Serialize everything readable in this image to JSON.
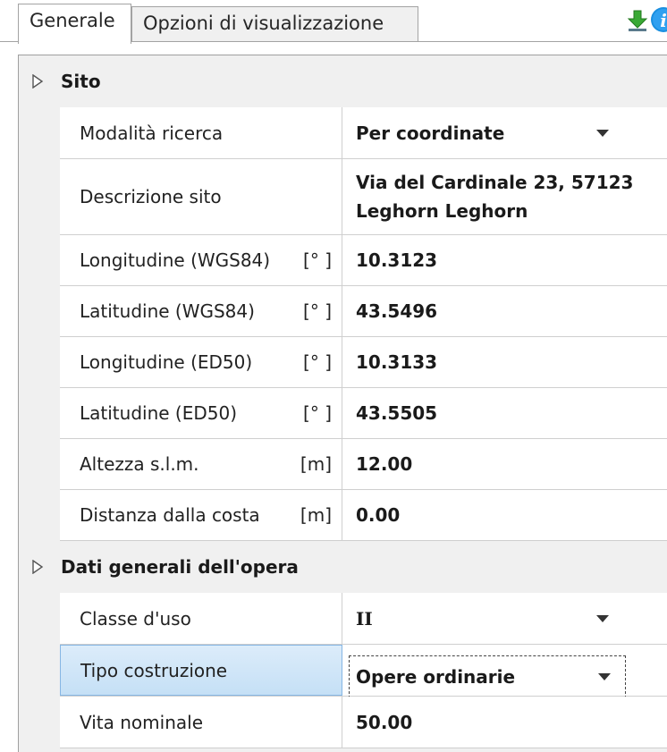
{
  "tabs": [
    {
      "label": "Generale",
      "active": true
    },
    {
      "label": "Opzioni di visualizzazione",
      "active": false
    }
  ],
  "toolbar": {
    "download_icon": "download-arrow-icon",
    "info_icon": "info-icon",
    "info_glyph": "i",
    "accent": "#1a8fe0",
    "download_color": "#3aa935"
  },
  "categories": [
    {
      "label": "Sito",
      "rows": [
        {
          "name": "Modalità ricerca",
          "unit": "",
          "value": "Per coordinate",
          "dropdown": true
        },
        {
          "name": "Descrizione sito",
          "unit": "",
          "value": "Via del Cardinale 23, 57123 Leghorn Leghorn"
        },
        {
          "name": "Longitudine (WGS84)",
          "unit": "[° ]",
          "value": "10.3123"
        },
        {
          "name": "Latitudine (WGS84)",
          "unit": "[° ]",
          "value": "43.5496"
        },
        {
          "name": "Longitudine (ED50)",
          "unit": "[° ]",
          "value": "10.3133"
        },
        {
          "name": "Latitudine (ED50)",
          "unit": "[° ]",
          "value": "43.5505"
        },
        {
          "name": "Altezza s.l.m.",
          "unit": "[m]",
          "value": "12.00"
        },
        {
          "name": "Distanza dalla costa",
          "unit": "[m]",
          "value": "0.00"
        }
      ]
    },
    {
      "label": "Dati generali dell'opera",
      "rows": [
        {
          "name": "Classe d'uso",
          "unit": "",
          "value": "II",
          "dropdown": true
        },
        {
          "name": "Tipo costruzione",
          "unit": "",
          "value": "Opere ordinarie",
          "dropdown": true,
          "selected": true
        },
        {
          "name": "Vita nominale",
          "unit": "",
          "value": "50.00"
        }
      ]
    }
  ]
}
